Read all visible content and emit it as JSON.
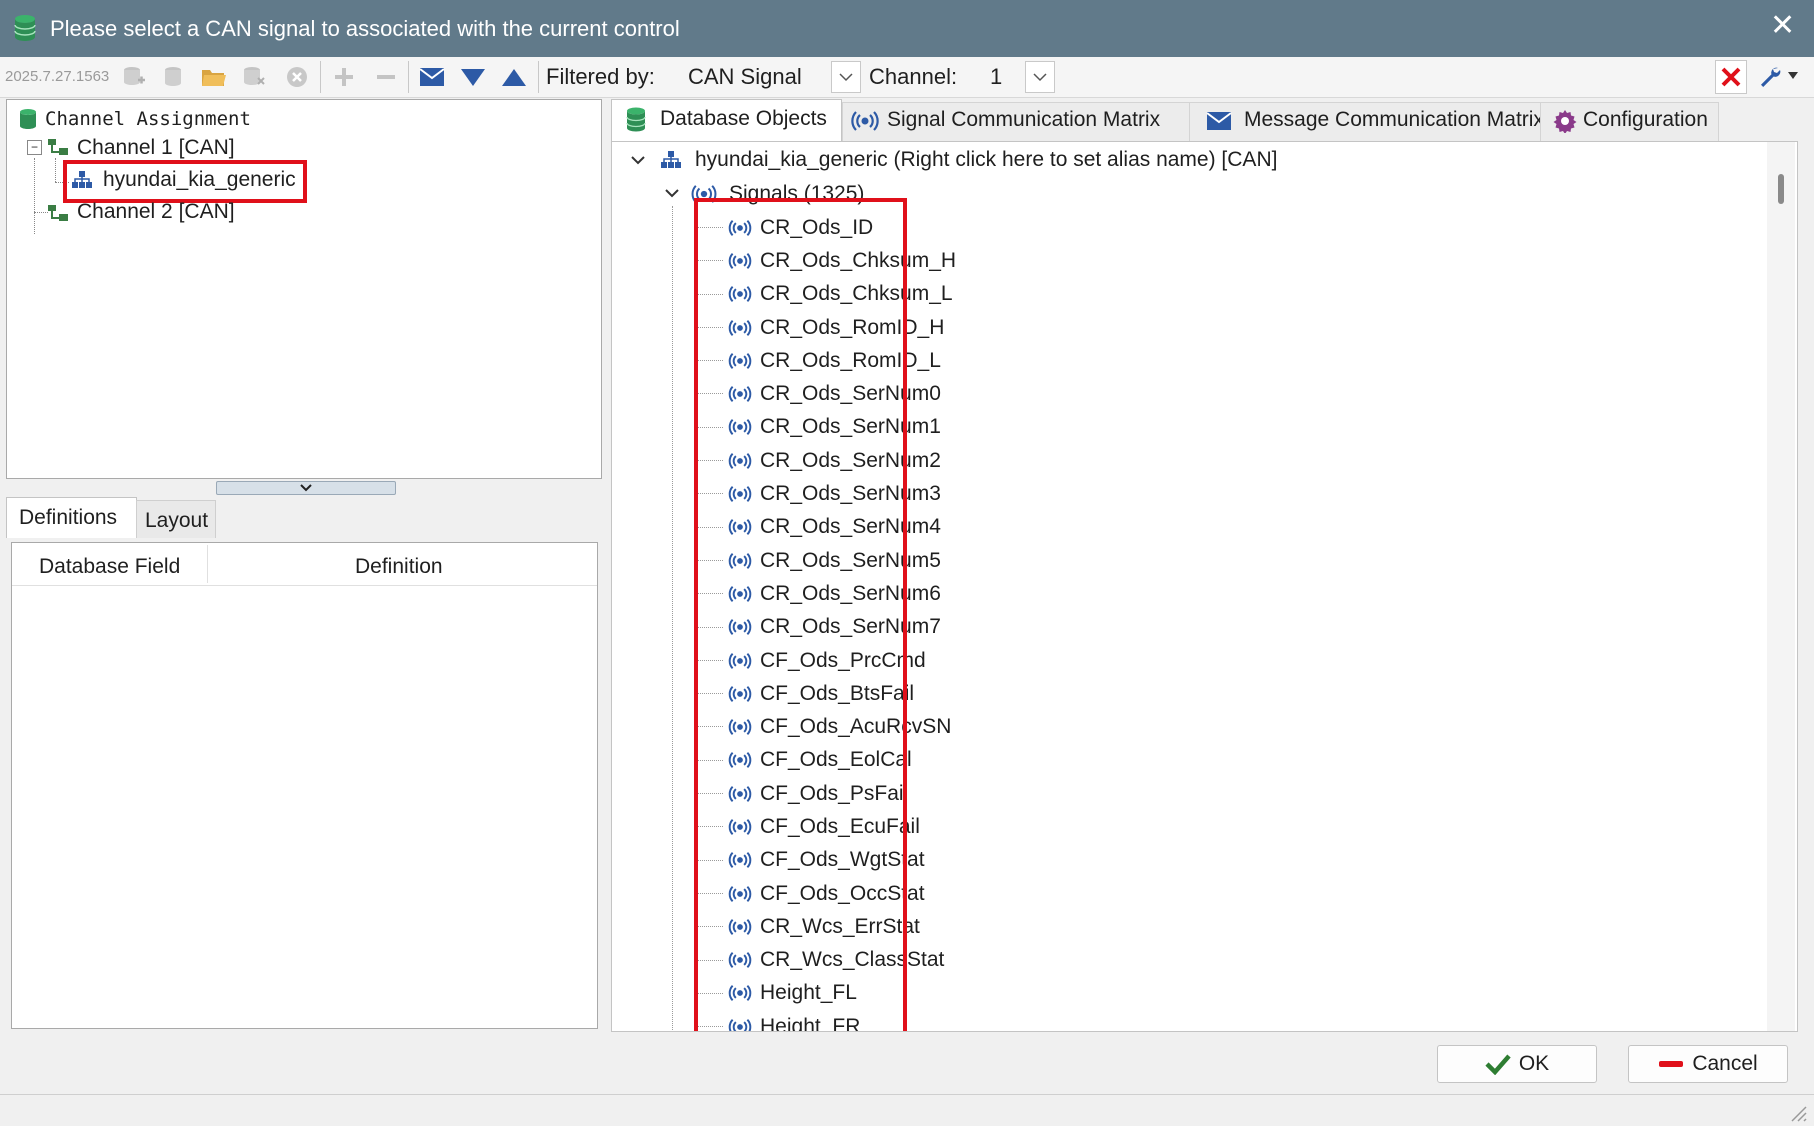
{
  "window": {
    "title": "Please select a CAN signal to associated with the current control",
    "close_glyph": "✕"
  },
  "toolbar": {
    "version": "2025.7.27.1563",
    "filtered_by_label": "Filtered by:",
    "filtered_by_value": "CAN Signal",
    "channel_label": "Channel:",
    "channel_value": "1"
  },
  "channel_assignment": {
    "header": "Channel Assignment",
    "channels": [
      {
        "label": "Channel 1 [CAN]",
        "children": [
          "hyundai_kia_generic"
        ]
      },
      {
        "label": "Channel 2 [CAN]"
      }
    ]
  },
  "definitions": {
    "tabs": [
      "Definitions",
      "Layout"
    ],
    "columns": [
      "Database Field",
      "Definition"
    ]
  },
  "right_tabs": [
    "Database Objects",
    "Signal Communication Matrix",
    "Message Communication Matrix",
    "Configuration"
  ],
  "db_tree": {
    "root": "hyundai_kia_generic (Right click here to set alias name) [CAN]",
    "signals_group": "Signals (1325)",
    "signals": [
      "CR_Ods_ID",
      "CR_Ods_Chksum_H",
      "CR_Ods_Chksum_L",
      "CR_Ods_RomID_H",
      "CR_Ods_RomID_L",
      "CR_Ods_SerNum0",
      "CR_Ods_SerNum1",
      "CR_Ods_SerNum2",
      "CR_Ods_SerNum3",
      "CR_Ods_SerNum4",
      "CR_Ods_SerNum5",
      "CR_Ods_SerNum6",
      "CR_Ods_SerNum7",
      "CF_Ods_PrcCmd",
      "CF_Ods_BtsFail",
      "CF_Ods_AcuRcvSN",
      "CF_Ods_EolCal",
      "CF_Ods_PsFail",
      "CF_Ods_EcuFail",
      "CF_Ods_WgtStat",
      "CF_Ods_OccStat",
      "CR_Wcs_ErrStat",
      "CR_Wcs_ClassStat",
      "Height_FL",
      "Height_FR"
    ]
  },
  "buttons": {
    "ok": "OK",
    "cancel": "Cancel"
  },
  "colors": {
    "titlebar": "#617a8a",
    "highlight": "#e0101a",
    "icon_blue": "#2d5aa6",
    "icon_green": "#3a7d44"
  }
}
